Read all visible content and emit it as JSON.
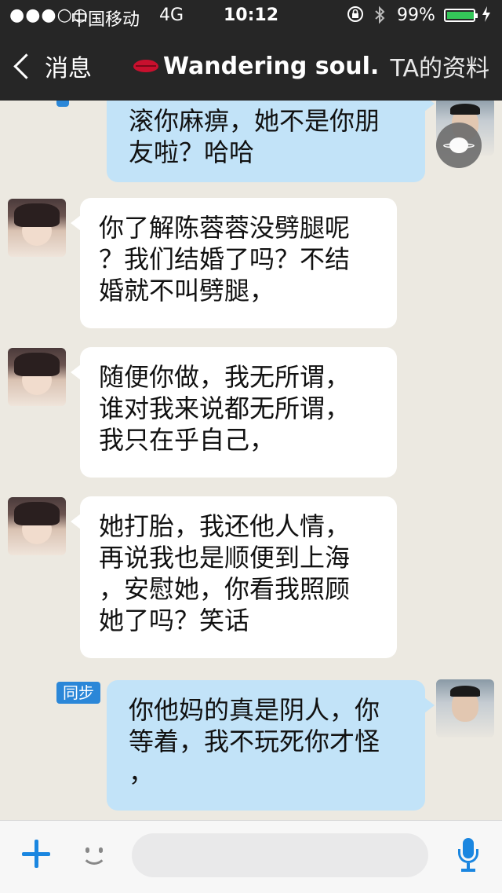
{
  "status_bar": {
    "signal": "●●●○○",
    "carrier": "中国移动",
    "network": "4G",
    "time": "10:12",
    "battery_percent": "99%",
    "battery_level": 0.99,
    "lock_icon": "rotation-lock-icon",
    "bluetooth_icon": "bluetooth-icon",
    "charging_icon": "charging-bolt-icon"
  },
  "nav": {
    "back_label": "消息",
    "title": "Wandering soul.",
    "title_icon": "lips-icon",
    "profile_label": "TA的资料"
  },
  "messages": [
    {
      "side": "right",
      "lines": [
        "滚你麻痹，她不是你朋",
        "友啦？哈哈"
      ]
    },
    {
      "side": "left",
      "lines": [
        "你了解陈蓉蓉没劈腿呢",
        "？我们结婚了吗？不结",
        "婚就不叫劈腿，"
      ]
    },
    {
      "side": "left",
      "lines": [
        "随便你做，我无所谓，",
        "谁对我来说都无所谓，",
        "我只在乎自己，"
      ]
    },
    {
      "side": "left",
      "lines": [
        "她打胎，我还他人情，",
        "再说我也是顺便到上海",
        "，安慰她，你看我照顾",
        "她了吗？笑话"
      ]
    },
    {
      "side": "right",
      "sync_label": "同步",
      "lines": [
        "你他妈的真是阴人，你",
        "等着，我不玩死你才怪",
        "，"
      ]
    }
  ],
  "input": {
    "value": "",
    "placeholder": "",
    "plus_icon": "plus-icon",
    "emoji_icon": "smiley-icon",
    "voice_icon": "microphone-icon"
  },
  "colors": {
    "bar": "#262626",
    "chat_bg": "#ece9e1",
    "bubble_in": "#ffffff",
    "bubble_out": "#c2e3f8",
    "accent": "#1a86e0"
  }
}
